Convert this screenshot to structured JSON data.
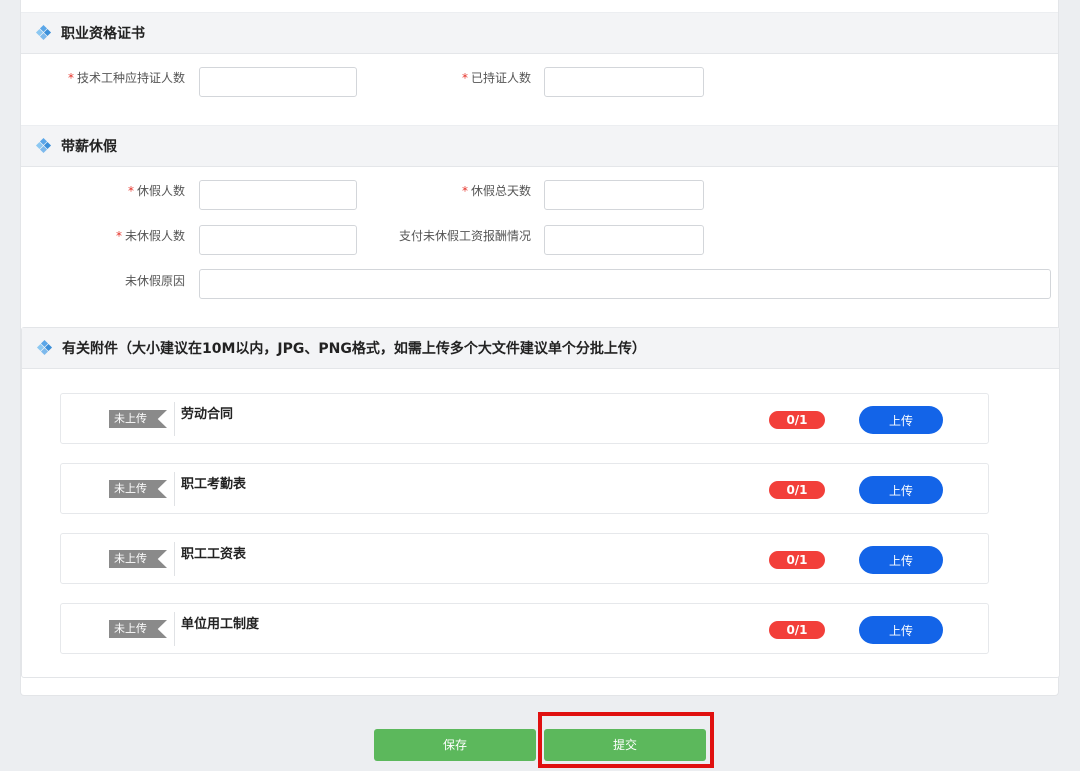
{
  "sections": {
    "cert": {
      "title": "职业资格证书"
    },
    "leave": {
      "title": "带薪休假"
    },
    "attach": {
      "title": "有关附件（大小建议在10M以内，JPG、PNG格式，如需上传多个大文件建议单个分批上传）"
    }
  },
  "cert_fields": {
    "tech_holders_required": {
      "label": "技术工种应持证人数",
      "required": "*",
      "value": ""
    },
    "certified_holders": {
      "label": "已持证人数",
      "required": "*",
      "value": ""
    }
  },
  "leave_fields": {
    "leave_count": {
      "label": "休假人数",
      "required": "*",
      "value": ""
    },
    "leave_total_days": {
      "label": "休假总天数",
      "required": "*",
      "value": ""
    },
    "no_leave_count": {
      "label": "未休假人数",
      "required": "*",
      "value": ""
    },
    "unpaid_leave_compensation": {
      "label": "支付未休假工资报酬情况",
      "value": ""
    },
    "no_leave_reason": {
      "label": "未休假原因",
      "value": ""
    }
  },
  "attachments": [
    {
      "tag": "未上传",
      "title": "劳动合同",
      "count": "0/1",
      "button": "上传"
    },
    {
      "tag": "未上传",
      "title": "职工考勤表",
      "count": "0/1",
      "button": "上传"
    },
    {
      "tag": "未上传",
      "title": "职工工资表",
      "count": "0/1",
      "button": "上传"
    },
    {
      "tag": "未上传",
      "title": "单位用工制度",
      "count": "0/1",
      "button": "上传"
    }
  ],
  "actions": {
    "save": "保存",
    "submit": "提交"
  },
  "colors": {
    "primary_blue": "#1364e8",
    "badge_red": "#f23f3a",
    "save_green": "#5cb85c",
    "highlight_red": "#e01010"
  }
}
